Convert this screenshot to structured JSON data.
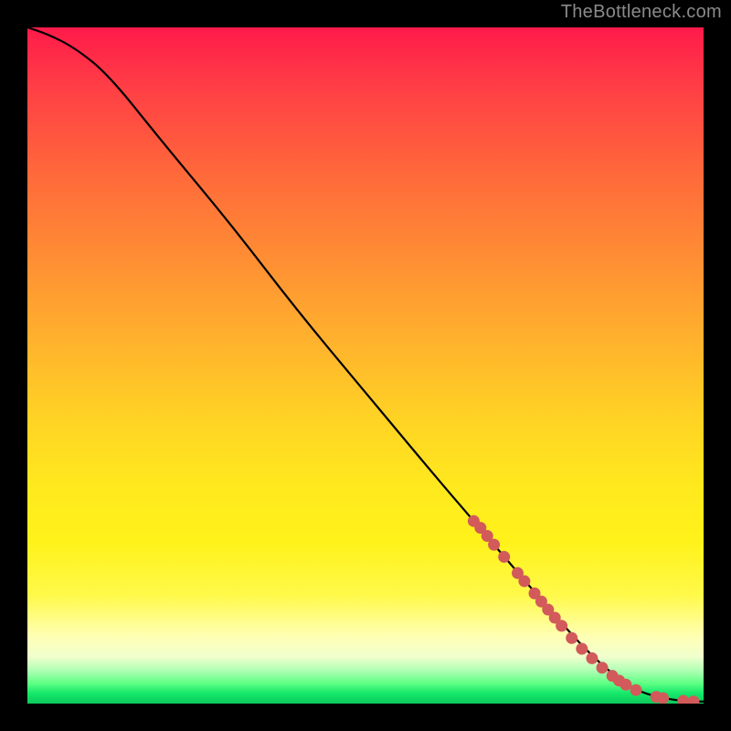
{
  "attribution": "TheBottleneck.com",
  "colors": {
    "page_bg": "#000000",
    "attribution_text": "#8a8a8a",
    "curve": "#000000",
    "dot_fill": "#d25a5a",
    "gradient_top": "#ff1a4a",
    "gradient_bottom": "#0dc95b"
  },
  "chart_data": {
    "type": "line",
    "title": "",
    "xlabel": "",
    "ylabel": "",
    "xlim": [
      0,
      100
    ],
    "ylim": [
      0,
      100
    ],
    "curve": {
      "x": [
        0,
        3,
        7,
        12,
        20,
        30,
        40,
        50,
        60,
        66,
        72,
        78,
        83,
        87,
        90,
        93,
        96,
        98,
        100
      ],
      "y": [
        100,
        99,
        97,
        93,
        83,
        71,
        58,
        46,
        34,
        27,
        20,
        13,
        7.5,
        4,
        2,
        1,
        0.5,
        0.3,
        0.3
      ]
    },
    "series": [
      {
        "name": "highlighted-points",
        "type": "scatter",
        "x": [
          66.0,
          67.0,
          68.0,
          69.0,
          70.5,
          72.5,
          73.5,
          75.0,
          76.0,
          77.0,
          78.0,
          79.0,
          80.5,
          82.0,
          83.5,
          85.0,
          86.5,
          87.5,
          88.5,
          90.0,
          93.0,
          94.0,
          97.0,
          98.5
        ],
        "y": [
          27.0,
          26.0,
          24.8,
          23.5,
          21.7,
          19.3,
          18.1,
          16.3,
          15.1,
          13.9,
          12.7,
          11.5,
          9.7,
          8.1,
          6.7,
          5.3,
          4.1,
          3.4,
          2.8,
          2.0,
          1.0,
          0.8,
          0.4,
          0.3
        ],
        "marker_radius_px": 6.5
      }
    ]
  }
}
